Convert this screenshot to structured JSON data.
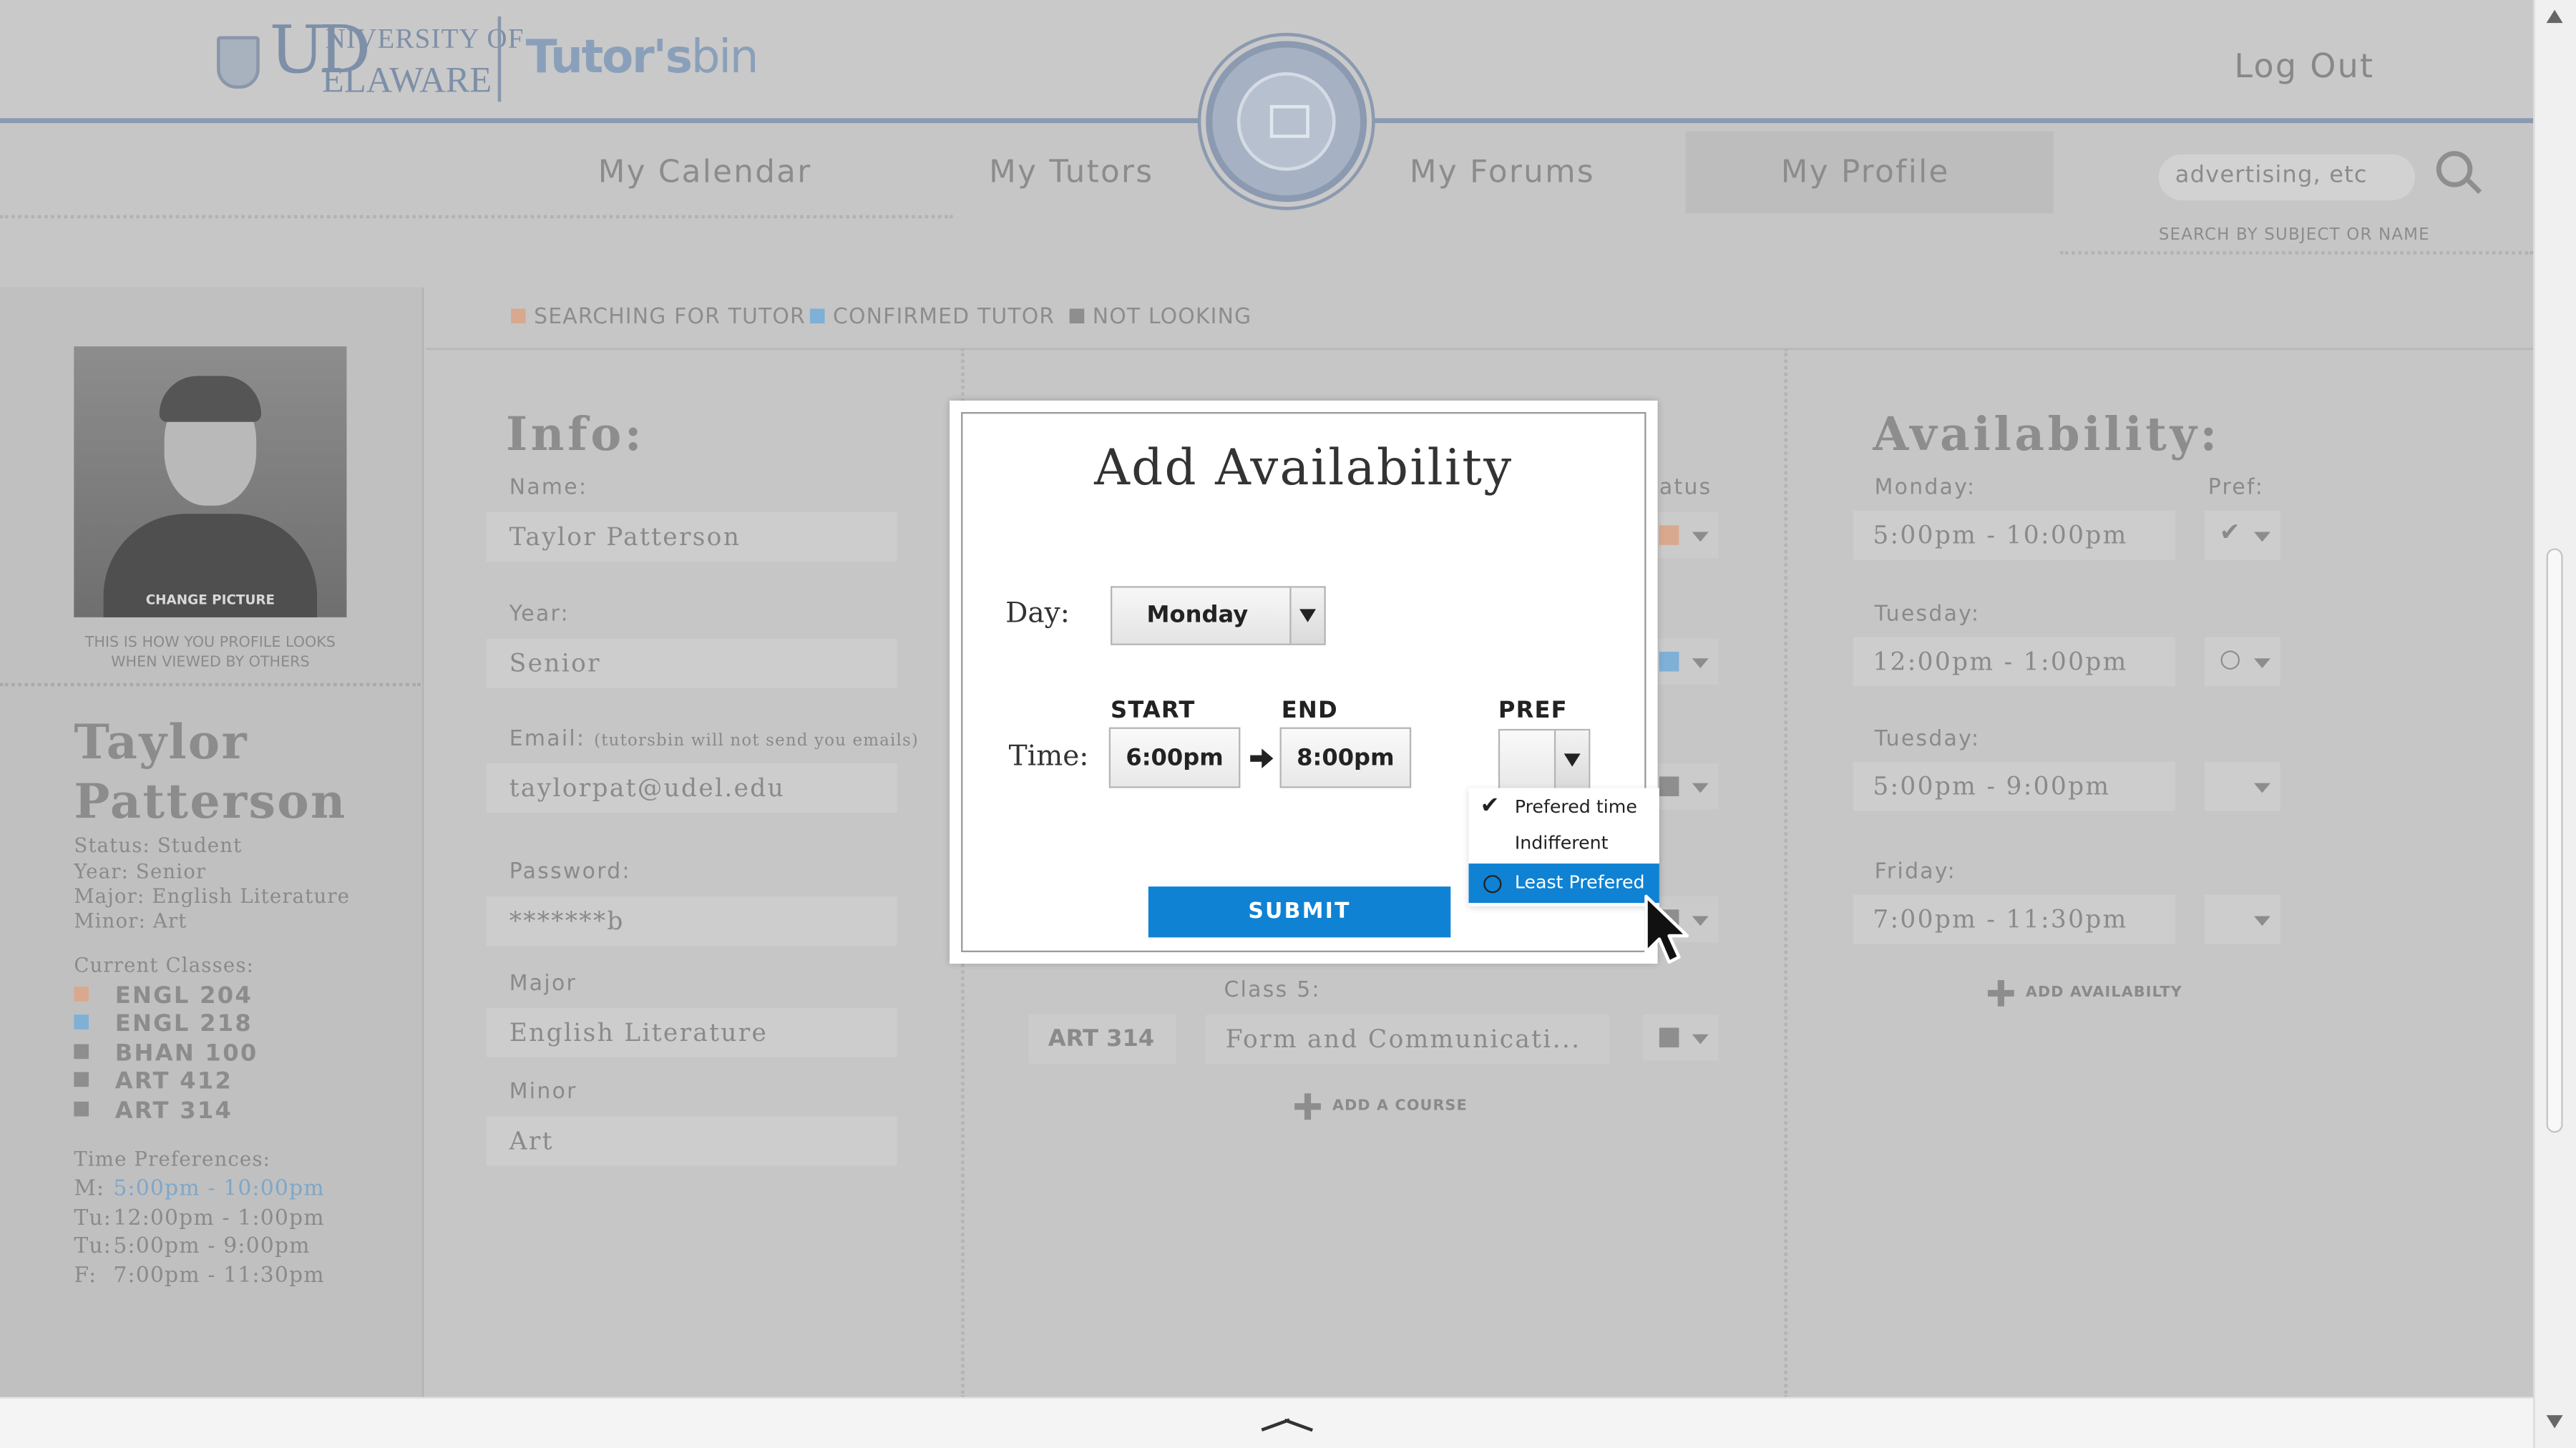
{
  "header": {
    "logo_ud": "UD",
    "logo_university": "NIVERSITY OF",
    "logo_delaware": "ELAWARE",
    "logo_tutors": "Tutor's",
    "logo_bin": "bin",
    "logout": "Log Out"
  },
  "nav": {
    "items": [
      "My Calendar",
      "My Tutors",
      "My Forums",
      "My Profile"
    ],
    "active": "My Profile",
    "search_placeholder": "advertising, etc",
    "search_hint": "SEARCH BY SUBJECT OR NAME"
  },
  "legend": [
    {
      "label": "SEARCHING FOR TUTOR",
      "color": "#d9a98f"
    },
    {
      "label": "CONFIRMED TUTOR",
      "color": "#7fb0d6"
    },
    {
      "label": "NOT LOOKING",
      "color": "#8e8e8e"
    }
  ],
  "sidebar": {
    "change_picture": "CHANGE PICTURE",
    "profile_note": "THIS IS HOW YOU PROFILE LOOKS WHEN VIEWED BY OTHERS",
    "first_name": "Taylor",
    "last_name": "Patterson",
    "status": "Status: Student",
    "year": "Year: Senior",
    "major": "Major: English Literature",
    "minor": "Minor: Art",
    "classes_label": "Current Classes:",
    "classes": [
      {
        "code": "ENGL 204",
        "color": "#d9a98f"
      },
      {
        "code": "ENGL 218",
        "color": "#7fb0d6"
      },
      {
        "code": "BHAN 100",
        "color": "#8e8e8e"
      },
      {
        "code": "ART 412",
        "color": "#8e8e8e"
      },
      {
        "code": "ART 314",
        "color": "#8e8e8e"
      }
    ],
    "time_pref_label": "Time Preferences:",
    "time_prefs": [
      {
        "day": "M:",
        "time": "5:00pm - 10:00pm",
        "highlight": true
      },
      {
        "day": "Tu:",
        "time": "12:00pm - 1:00pm",
        "highlight": false
      },
      {
        "day": "Tu:",
        "time": "5:00pm - 9:00pm",
        "highlight": false
      },
      {
        "day": "F:",
        "time": "7:00pm - 11:30pm",
        "highlight": false
      }
    ]
  },
  "info": {
    "heading": "Info:",
    "name_label": "Name:",
    "name_value": "Taylor Patterson",
    "year_label": "Year:",
    "year_value": "Senior",
    "email_label": "Email:",
    "email_note": "(tutorsbin will not send you emails)",
    "email_value": "taylorpat@udel.edu",
    "password_label": "Password:",
    "password_value": "*******b",
    "major_label": "Major",
    "major_value": "English Literature",
    "minor_label": "Minor",
    "minor_value": "Art"
  },
  "courses": {
    "status_label_fragment": "atus",
    "class5_label": "Class 5:",
    "class5_code": "ART 314",
    "class5_name": "Form and Communicati...",
    "add_course": "ADD A COURSE"
  },
  "availability": {
    "heading": "Availability:",
    "pref_label": "Pref:",
    "rows": [
      {
        "day": "Monday:",
        "time": "5:00pm - 10:00pm",
        "pref": "check-icon"
      },
      {
        "day": "Tuesday:",
        "time": "12:00pm - 1:00pm",
        "pref": "circle-icon"
      },
      {
        "day": "Tuesday:",
        "time": "5:00pm - 9:00pm",
        "pref": ""
      },
      {
        "day": "Friday:",
        "time": "7:00pm - 11:30pm",
        "pref": ""
      }
    ],
    "add_availability": "ADD AVAILABILTY"
  },
  "modal": {
    "title": "Add Availability",
    "day_label": "Day:",
    "day_value": "Monday",
    "time_label": "Time:",
    "start_label": "START",
    "end_label": "END",
    "pref_label": "PREF",
    "start_value": "6:00pm",
    "end_value": "8:00pm",
    "pref_options": [
      "Prefered time",
      "Indifferent",
      "Least Prefered"
    ],
    "pref_highlighted": "Least Prefered",
    "submit": "SUBMIT",
    "accent_color": "#0f82d4"
  }
}
